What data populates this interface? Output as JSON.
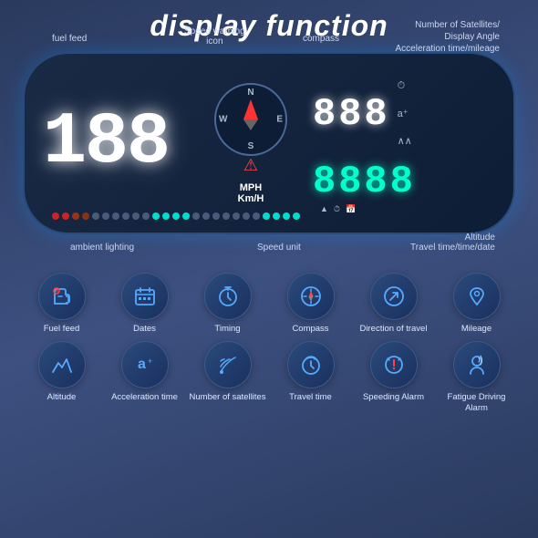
{
  "title": "display function",
  "hud": {
    "speed": "188",
    "speed_unit_line1": "MPH",
    "speed_unit_line2": "Km/H",
    "compass_labels": {
      "N": "N",
      "S": "S",
      "E": "E",
      "W": "W"
    },
    "top_digits": "888",
    "bottom_digits": "8888",
    "labels": {
      "fuel_feed": "fuel feed",
      "speed_warning": "Speed warning\nicon",
      "compass": "compass",
      "num_satellites": "Number of Satellites/\nDisplay Angle\nAcceleration time/mileage",
      "ambient": "ambient lighting",
      "speed_unit": "Speed unit",
      "altitude_travel": "Altitude\nTravel time/time/date"
    }
  },
  "bottom_icons_row1": [
    {
      "id": "fuel-feed",
      "label": "Fuel feed"
    },
    {
      "id": "dates",
      "label": "Dates"
    },
    {
      "id": "timing",
      "label": "Timing"
    },
    {
      "id": "compass",
      "label": "Compass"
    },
    {
      "id": "direction",
      "label": "Direction of travel"
    },
    {
      "id": "mileage",
      "label": "Mileage"
    }
  ],
  "bottom_icons_row2": [
    {
      "id": "altitude",
      "label": "Altitude"
    },
    {
      "id": "acceleration",
      "label": "Acceleration time"
    },
    {
      "id": "satellites",
      "label": "Number of satellites"
    },
    {
      "id": "travel-time",
      "label": "Travel time"
    },
    {
      "id": "speeding-alarm",
      "label": "Speeding Alarm"
    },
    {
      "id": "fatigue",
      "label": "Fatigue Driving Alarm"
    }
  ]
}
